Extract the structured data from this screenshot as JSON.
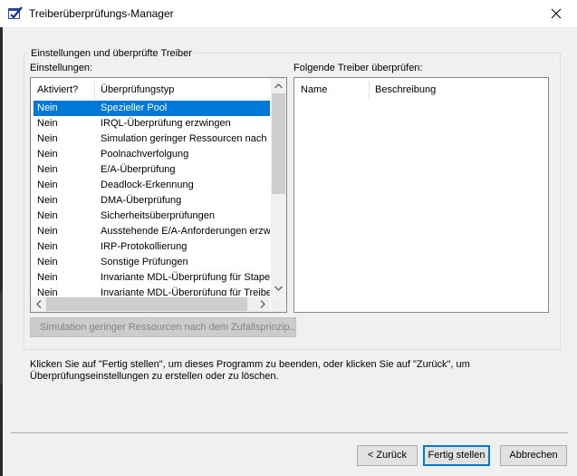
{
  "window": {
    "title": "Treiberüberprüfungs-Manager"
  },
  "group": {
    "legend": "Einstellungen und überprüfte Treiber",
    "settings_label": "Einstellungen:",
    "drivers_label": "Folgende Treiber überprüfen:"
  },
  "settings_table": {
    "columns": [
      "Aktiviert?",
      "Überprüfungstyp"
    ],
    "rows": [
      {
        "enabled": "Nein",
        "type": "Spezieller Pool"
      },
      {
        "enabled": "Nein",
        "type": "IRQL-Überprüfung erzwingen"
      },
      {
        "enabled": "Nein",
        "type": "Simulation geringer Ressourcen nach d"
      },
      {
        "enabled": "Nein",
        "type": "Poolnachverfolgung"
      },
      {
        "enabled": "Nein",
        "type": "E/A-Überprüfung"
      },
      {
        "enabled": "Nein",
        "type": "Deadlock-Erkennung"
      },
      {
        "enabled": "Nein",
        "type": "DMA-Überprüfung"
      },
      {
        "enabled": "Nein",
        "type": "Sicherheitsüberprüfungen"
      },
      {
        "enabled": "Nein",
        "type": "Ausstehende E/A-Anforderungen erzwi."
      },
      {
        "enabled": "Nein",
        "type": "IRP-Protokollierung"
      },
      {
        "enabled": "Nein",
        "type": "Sonstige Prüfungen"
      },
      {
        "enabled": "Nein",
        "type": "Invariante MDL-Überprüfung für Stapel"
      },
      {
        "enabled": "Nein",
        "type": "Invariante MDL-Überprüfung für Treiber"
      }
    ],
    "selected_index": 0
  },
  "drivers_table": {
    "columns": [
      "Name",
      "Beschreibung"
    ]
  },
  "low_resource_button": "Simulation geringer Ressourcen nach dem Zufallsprinzip...",
  "info_text_line1": "Klicken Sie auf \"Fertig stellen\", um dieses Programm zu beenden, oder klicken Sie auf \"Zurück\", um",
  "info_text_line2": "Überprüfungseinstellungen zu erstellen oder zu löschen.",
  "buttons": {
    "back": "< Zurück",
    "finish": "Fertig stellen",
    "cancel": "Abbrechen"
  },
  "colors": {
    "selection": "#0078d7",
    "dialog_bg": "#f0f0f0"
  }
}
